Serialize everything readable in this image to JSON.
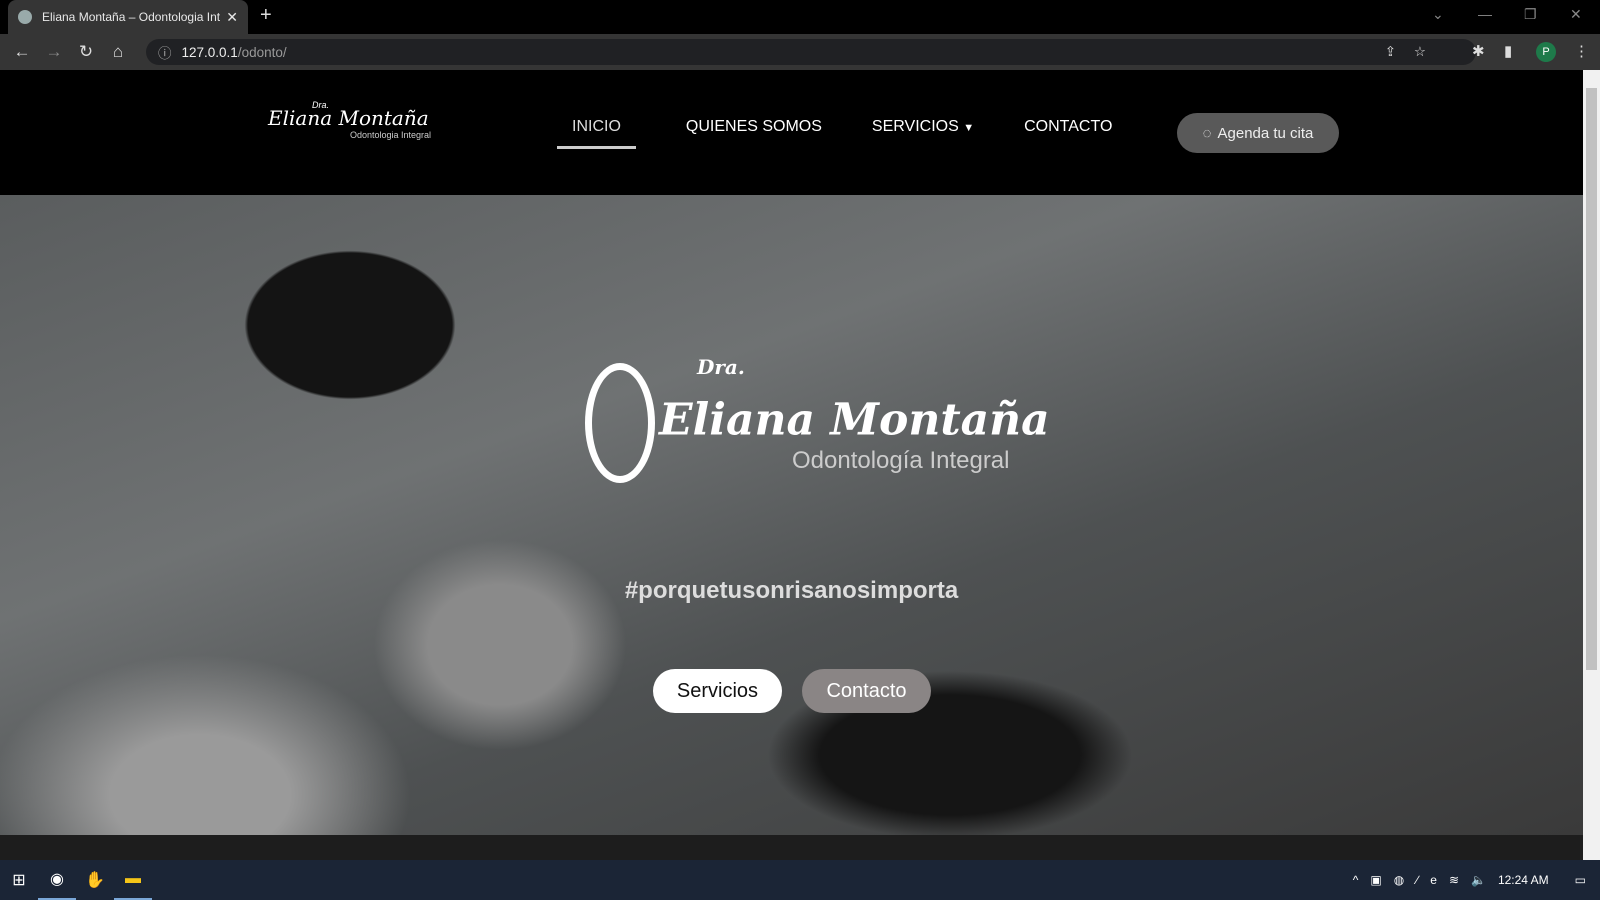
{
  "browser": {
    "tab_title": "Eliana Montaña – Odontologia Integral",
    "url_host": "127.0.0.1",
    "url_path": "/odonto/",
    "profile_initial": "P"
  },
  "site": {
    "logo": {
      "dra": "Dra.",
      "name": "Eliana Montaña",
      "tagline": "Odontologia Integral"
    },
    "nav": [
      {
        "label": "INICIO",
        "active": true
      },
      {
        "label": "QUIENES SOMOS"
      },
      {
        "label": "SERVICIOS",
        "dropdown": true
      },
      {
        "label": "CONTACTO"
      }
    ],
    "cta": "Agenda tu cita",
    "hero": {
      "logo_dra": "Dra.",
      "logo_name": "Eliana Montaña",
      "logo_tagline": "Odontología Integral",
      "hashtag": "#porquetusonrisanosimporta",
      "btn_primary": "Servicios",
      "btn_secondary": "Contacto"
    }
  },
  "taskbar": {
    "time": "12:24 AM"
  }
}
